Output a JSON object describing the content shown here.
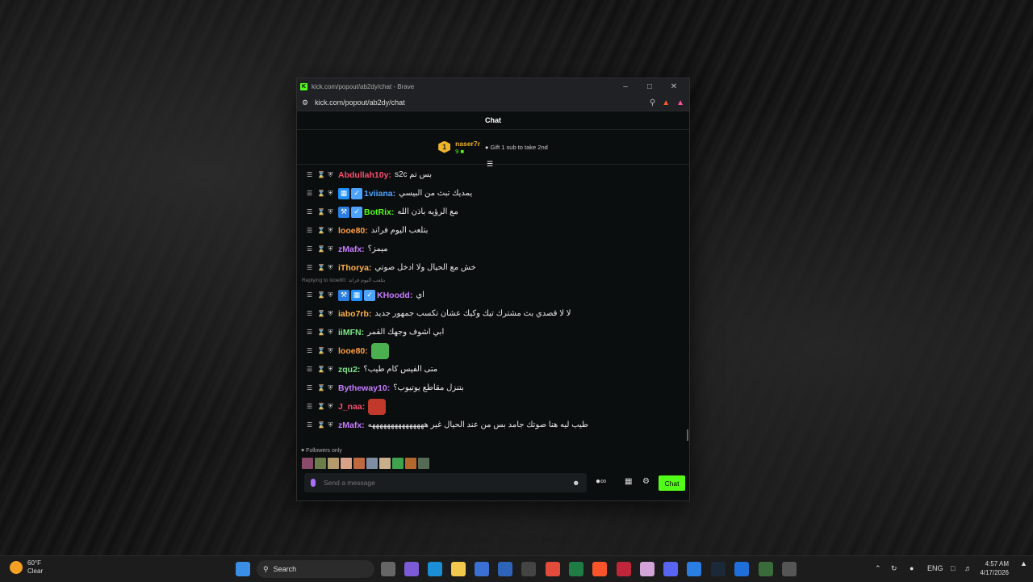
{
  "window": {
    "title": "kick.com/popout/ab2dy/chat - Brave",
    "url": "kick.com/popout/ab2dy/chat"
  },
  "chat": {
    "header": "Chat",
    "pinned": {
      "rank": "1",
      "username": "naser7r",
      "gift_count": "9",
      "cta": "Gift 1 sub to take 2nd"
    },
    "messages": [
      {
        "user": "Abdullah10y:",
        "text": "s2c بس تم",
        "color": "#ff4d6d",
        "icons": []
      },
      {
        "user": "1viiana:",
        "text": "يمديك تبث من البيسي",
        "color": "#4da3ff",
        "icons": [
          "og-badge",
          "verified-badge"
        ]
      },
      {
        "user": "BotRix:",
        "text": "مع الرؤيه باذن الله",
        "color": "#53fc18",
        "icons": [
          "mod-badge",
          "verified-badge"
        ]
      },
      {
        "user": "looe80:",
        "text": "بتلعب اليوم فراند",
        "color": "#ff9f40",
        "icons": []
      },
      {
        "user": "zMafx:",
        "text": "ميمز؟",
        "color": "#c77dff",
        "icons": []
      },
      {
        "user": "iThorya:",
        "text": "خش مع الحيال ولا ادخل صوتي",
        "color": "#ffb347",
        "icons": []
      },
      {
        "reply": "Replying to looe80: بتلعب اليوم فراند"
      },
      {
        "user": "KHoodd:",
        "text": "اي",
        "color": "#c77dff",
        "icons": [
          "mod-badge",
          "og-badge",
          "verified-badge"
        ]
      },
      {
        "user": "iabo7rb:",
        "text": "لا لا قصدي بث مشترك تيك وكيك عشان تكسب جمهور جديد",
        "color": "#ffb347",
        "icons": []
      },
      {
        "user": "iiMFN:",
        "text": "ابي اشوف وجهك القمر",
        "color": "#7ee787",
        "icons": []
      },
      {
        "user": "looe80:",
        "text": "",
        "color": "#ff9f40",
        "icons": [],
        "emote": "#4caf50"
      },
      {
        "user": "zqu2:",
        "text": "متى الفيس كام طيب؟",
        "color": "#7ee787",
        "icons": []
      },
      {
        "user": "Bytheway10:",
        "text": "بتنزل مقاطع يوتيوب؟",
        "color": "#c77dff",
        "icons": []
      },
      {
        "user": "J_naa:",
        "text": "",
        "color": "#ff4d6d",
        "icons": [],
        "emote": "#c0392b"
      },
      {
        "user": "zMafx:",
        "text": "طيب ليه هنا صوتك جامد بس من عند الحيال غير هههههههههههههههه",
        "color": "#c77dff",
        "icons": []
      }
    ],
    "followers_label": "Followers only",
    "input_placeholder": "Send a message",
    "send_label": "Chat"
  },
  "taskbar": {
    "temperature": "60°F",
    "condition": "Clear",
    "search_label": "Search",
    "lang": "ENG",
    "time": "4:57 AM",
    "date": "4/17/2026"
  }
}
